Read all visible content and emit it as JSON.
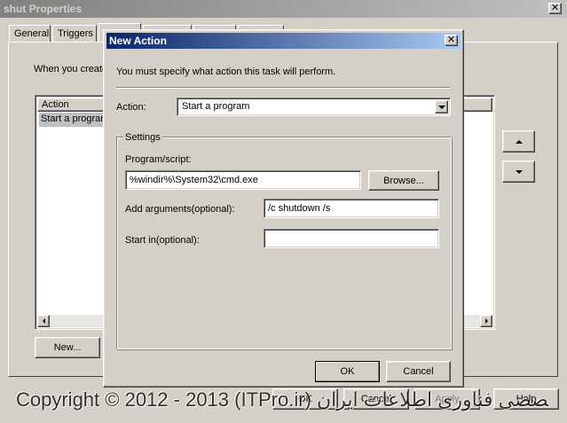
{
  "parent": {
    "title": "shut Properties",
    "tabs": [
      "General",
      "Triggers"
    ],
    "intro_text": "When you create",
    "list_header": "Action",
    "list_item": "Start a program",
    "new_button": "New...",
    "ok_button": "OK",
    "cancel_button": "Cancel",
    "apply_button": "Apply",
    "help_button": "Help"
  },
  "dialog": {
    "title": "New Action",
    "instruction": "You must specify what action this task will perform.",
    "action_label": "Action:",
    "action_value": "Start a program",
    "settings_group": "Settings",
    "program_label": "Program/script:",
    "program_value": "%windir%\\System32\\cmd.exe",
    "browse_button": "Browse...",
    "args_label": "Add arguments(optional):",
    "args_value": "/c shutdown /s",
    "startin_label": "Start in(optional):",
    "startin_value": "",
    "ok_button": "OK",
    "cancel_button": "Cancel"
  },
  "watermark": {
    "text": "Copyright © 2012 - 2013 (ITPro.ir) انجمن تخصصی فناوری اطلاعات ایران - ITPro"
  },
  "colors": {
    "titlebar_active": "#0a246a",
    "titlebar_active_end": "#a6caf0",
    "titlebar_inactive": "#808080",
    "face": "#d4d0c8",
    "selection": "#c0c0c0"
  },
  "icons": {
    "close": "close-icon",
    "dropdown": "chevron-down-icon",
    "move_up": "arrow-up-icon",
    "move_down": "arrow-down-icon"
  }
}
